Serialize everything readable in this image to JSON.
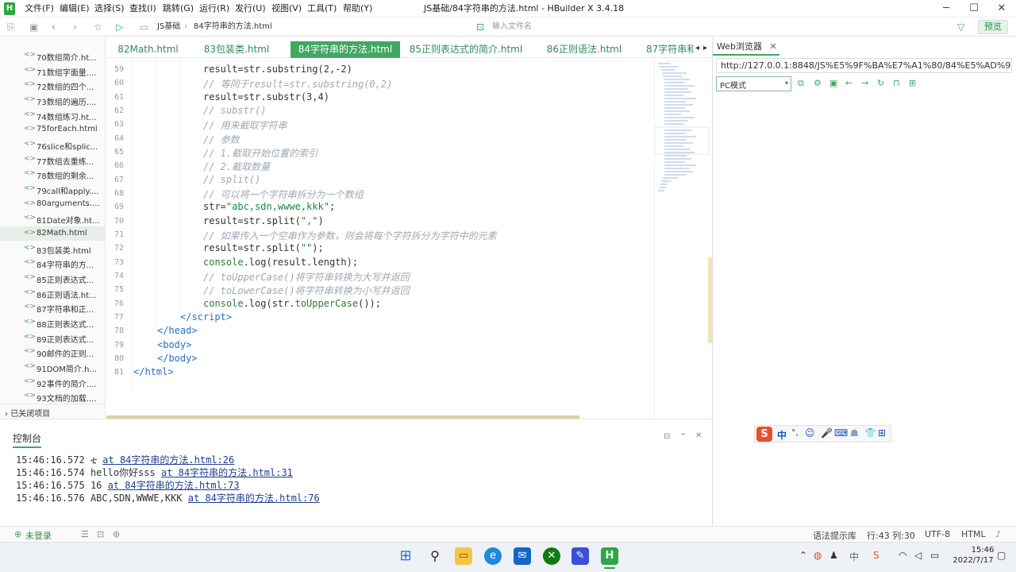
{
  "app": {
    "title": "JS基础/84字符串的方法.html - HBuilder X 3.4.18",
    "menu": [
      "文件(F)",
      "编辑(E)",
      "选择(S)",
      "查找(I)",
      "跳转(G)",
      "运行(R)",
      "发行(U)",
      "视图(V)",
      "工具(T)",
      "帮助(Y)"
    ]
  },
  "toolbar": {
    "breadcrumb": [
      "JS基础",
      "84字符串的方法.html"
    ],
    "file_input_placeholder": "输入文件名",
    "preview_label": "预览"
  },
  "sidebar": {
    "items": [
      {
        "label": "70数组简介.ht..."
      },
      {
        "label": "71数组字面量...."
      },
      {
        "label": "72数组的四个..."
      },
      {
        "label": "73数组的遍历...."
      },
      {
        "label": "74数组练习.ht..."
      },
      {
        "label": "75forEach.html"
      },
      {
        "label": "76slice和splic..."
      },
      {
        "label": "77数组去重练..."
      },
      {
        "label": "78数组的剩余..."
      },
      {
        "label": "79call和apply...."
      },
      {
        "label": "80arguments...."
      },
      {
        "label": "81Date对象.ht..."
      },
      {
        "label": "82Math.html"
      },
      {
        "label": "83包装类.html"
      },
      {
        "label": "84字符串的方..."
      },
      {
        "label": "85正则表达式..."
      },
      {
        "label": "86正则语法.ht..."
      },
      {
        "label": "87字符串和正..."
      },
      {
        "label": "88正则表达式..."
      },
      {
        "label": "89正则表达式..."
      },
      {
        "label": "90邮件的正则..."
      },
      {
        "label": "91DOM简介.h..."
      },
      {
        "label": "92事件的简介...."
      },
      {
        "label": "93文档的加载...."
      }
    ],
    "closed_projects": "已关闭项目"
  },
  "tabs": [
    {
      "label": "82Math.html"
    },
    {
      "label": "83包装类.html"
    },
    {
      "label": "84字符串的方法.html"
    },
    {
      "label": "85正则表达式的简介.html"
    },
    {
      "label": "86正则语法.html"
    },
    {
      "label": "87字符串和"
    }
  ],
  "editor": {
    "line_numbers": [
      "59",
      "60",
      "61",
      "62",
      "63",
      "64",
      "65",
      "66",
      "67",
      "68",
      "69",
      "70",
      "71",
      "72",
      "73",
      "74",
      "75",
      "76",
      "77",
      "78",
      "79",
      "80",
      "81"
    ]
  },
  "console": {
    "title": "控制台",
    "logs": [
      {
        "time": "15:46:16.572",
        "msg": "ቲ",
        "link": "at 84字符串的方法.html:26"
      },
      {
        "time": "15:46:16.574",
        "msg": "hello你好sss",
        "link": "at 84字符串的方法.html:31"
      },
      {
        "time": "15:46:16.575",
        "msg": "16",
        "link": "at 84字符串的方法.html:73"
      },
      {
        "time": "15:46:16.576",
        "msg": "ABC,SDN,WWWE,KKK",
        "link": "at 84字符串的方法.html:76"
      }
    ]
  },
  "statusbar": {
    "login": "未登录",
    "syntax": "语法提示库",
    "position": "行:43  列:30",
    "encoding": "UTF-8",
    "language": "HTML"
  },
  "browser": {
    "tab_label": "Web浏览器",
    "url": "http://127.0.0.1:8848/JS%E5%9F%BA%E7%A1%80/84%E5%AD%97%E7%AC%",
    "mode": "PC模式"
  },
  "ime": {
    "label": "中"
  },
  "taskbar": {
    "time": "15:46",
    "date": "2022/7/17",
    "tray_lang": "中"
  },
  "colors": {
    "accent": "#41a863",
    "link": "#1e3d8f",
    "comment": "#a0a8b0",
    "string": "#1a8a3a"
  }
}
